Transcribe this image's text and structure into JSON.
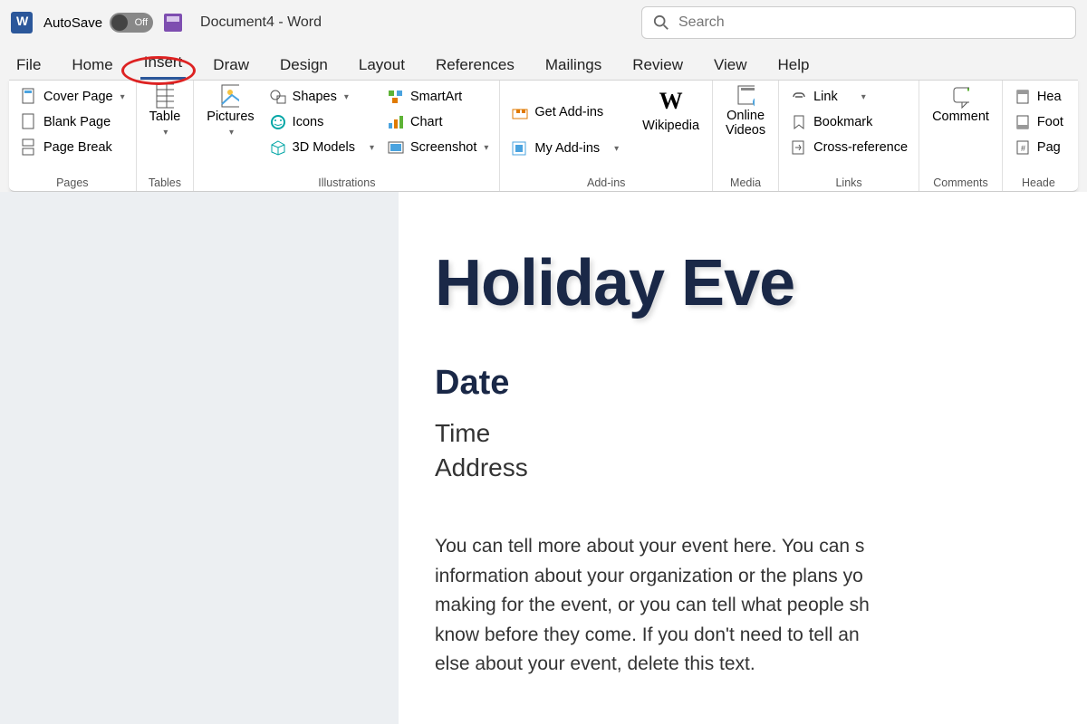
{
  "titlebar": {
    "autosave_label": "AutoSave",
    "autosave_state": "Off",
    "doc_title": "Document4  -  Word"
  },
  "search": {
    "placeholder": "Search"
  },
  "tabs": {
    "file": "File",
    "home": "Home",
    "insert": "Insert",
    "draw": "Draw",
    "design": "Design",
    "layout": "Layout",
    "references": "References",
    "mailings": "Mailings",
    "review": "Review",
    "view": "View",
    "help": "Help"
  },
  "ribbon": {
    "pages": {
      "label": "Pages",
      "cover_page": "Cover Page",
      "blank_page": "Blank Page",
      "page_break": "Page Break"
    },
    "tables": {
      "label": "Tables",
      "table": "Table"
    },
    "illustrations": {
      "label": "Illustrations",
      "pictures": "Pictures",
      "shapes": "Shapes",
      "icons": "Icons",
      "models": "3D Models",
      "smartart": "SmartArt",
      "chart": "Chart",
      "screenshot": "Screenshot"
    },
    "addins": {
      "label": "Add-ins",
      "get": "Get Add-ins",
      "my": "My Add-ins",
      "wikipedia": "Wikipedia"
    },
    "media": {
      "label": "Media",
      "online_videos": "Online Videos"
    },
    "links": {
      "label": "Links",
      "link": "Link",
      "bookmark": "Bookmark",
      "crossref": "Cross-reference"
    },
    "comments": {
      "label": "Comments",
      "comment": "Comment"
    },
    "headerfooter": {
      "label": "Heade",
      "header": "Hea",
      "footer": "Foot",
      "page_number": "Pag"
    }
  },
  "document": {
    "heading": "Holiday Eve",
    "date": "Date",
    "time": "Time",
    "address": "Address",
    "body": "You can tell more about your event here. You can s\ninformation about your organization or the plans yo\nmaking for the event, or you can tell what people sh\nknow before they come. If you don't need to tell an\nelse about your event, delete this text."
  }
}
